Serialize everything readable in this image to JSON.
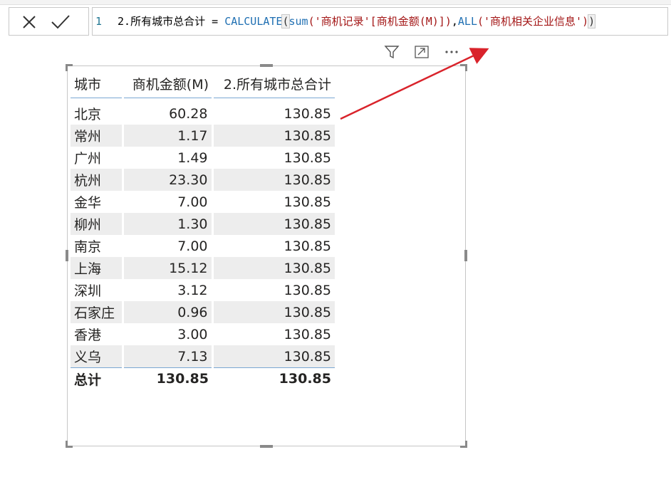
{
  "formula_bar": {
    "cancel_icon": "close-icon",
    "commit_icon": "check-icon",
    "line_number": "1",
    "measure_name": "2.所有城市总合计",
    "equals": " = ",
    "fn_calculate": "CALCULATE",
    "paren_open": "(",
    "fn_sum": "sum",
    "sum_args": "('商机记录'[商机金额(M)])",
    "comma": ",",
    "fn_all": "ALL",
    "all_args": "('商机相关企业信息')",
    "paren_close": ")"
  },
  "visual_toolbar": {
    "filter_icon": "filter-icon",
    "focus_icon": "focus-mode-icon",
    "more_icon": "more-options-icon"
  },
  "table": {
    "headers": [
      "城市",
      "商机金额(M)",
      "2.所有城市总合计"
    ],
    "rows": [
      [
        "北京",
        "60.28",
        "130.85"
      ],
      [
        "常州",
        "1.17",
        "130.85"
      ],
      [
        "广州",
        "1.49",
        "130.85"
      ],
      [
        "杭州",
        "23.30",
        "130.85"
      ],
      [
        "金华",
        "7.00",
        "130.85"
      ],
      [
        "柳州",
        "1.30",
        "130.85"
      ],
      [
        "南京",
        "7.00",
        "130.85"
      ],
      [
        "上海",
        "15.12",
        "130.85"
      ],
      [
        "深圳",
        "3.12",
        "130.85"
      ],
      [
        "石家庄",
        "0.96",
        "130.85"
      ],
      [
        "香港",
        "3.00",
        "130.85"
      ],
      [
        "义乌",
        "7.13",
        "130.85"
      ]
    ],
    "total": [
      "总计",
      "130.85",
      "130.85"
    ]
  },
  "colors": {
    "arrow": "#d9232b",
    "function": "#1f6fb2",
    "string": "#a31515",
    "row_alt": "#ededed",
    "header_rule": "#7aa7d3"
  }
}
